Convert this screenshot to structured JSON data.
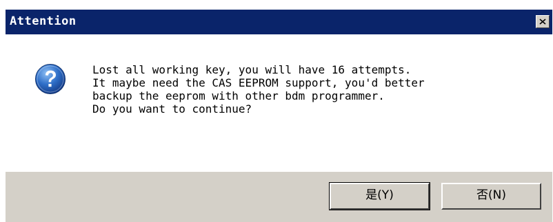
{
  "dialog": {
    "title": "Attention",
    "close_label": "Close",
    "message": "Lost all working key, you will have 16 attempts.\nIt maybe need the CAS EEPROM support, you'd better\nbackup the eeprom with other bdm programmer.\nDo you want to continue?",
    "icon": "question-icon",
    "buttons": {
      "yes_label": "是(Y)",
      "no_label": "否(N)"
    }
  },
  "colors": {
    "titlebar": "#0a246a",
    "titlebar_text": "#ffffff",
    "button_face": "#d4d0c8",
    "client_background": "#ffffff",
    "icon_blue": "#1f5fb8"
  }
}
